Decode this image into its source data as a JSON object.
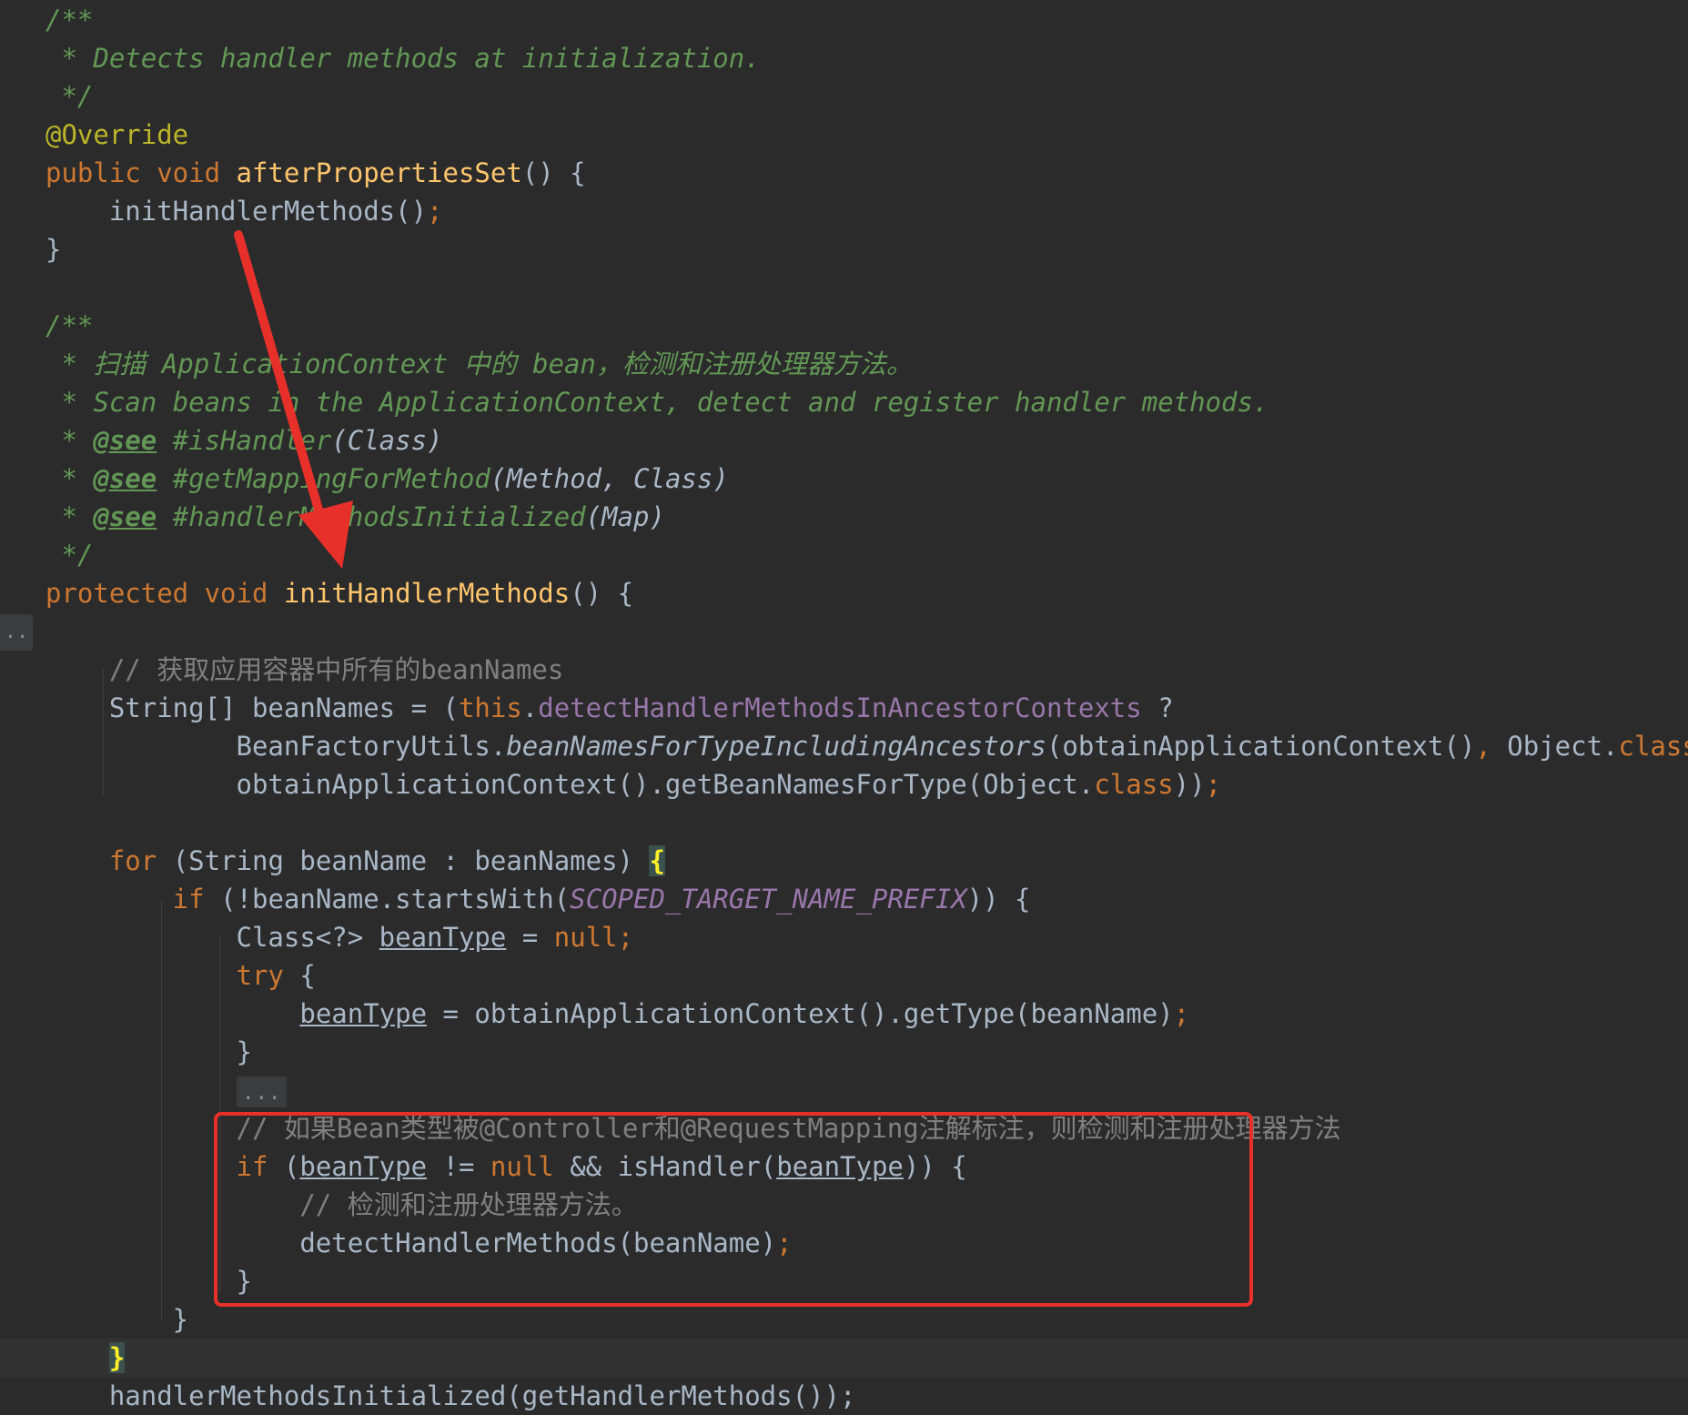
{
  "code": {
    "l01": "/**",
    "l02": " * Detects handler methods at initialization.",
    "l03": " */",
    "l04": "@Override",
    "l05_kw": "public void ",
    "l05_fn": "afterPropertiesSet",
    "l05_rest": "() {",
    "l06_call": "    initHandlerMethods()",
    "l06_semi": ";",
    "l07": "}",
    "l09": "/**",
    "l10": " * 扫描 ApplicationContext 中的 bean，检测和注册处理器方法。",
    "l11": " * Scan beans in the ApplicationContext, detect and register handler methods.",
    "l12_star": " * ",
    "l12_tag": "@see",
    "l12_ref": " #isHandler",
    "l12_params": "(Class)",
    "l13_star": " * ",
    "l13_tag": "@see",
    "l13_ref": " #getMappingForMethod",
    "l13_params": "(Method, Class)",
    "l14_star": " * ",
    "l14_tag": "@see",
    "l14_ref": " #handlerMethodsInitialized",
    "l14_params": "(Map)",
    "l15": " */",
    "l16_kw": "protected void ",
    "l16_fn": "initHandlerMethods",
    "l16_rest": "() {",
    "l18": "    // 获取应用容器中所有的beanNames",
    "l19_a": "    String[] beanNames = (",
    "l19_this": "this",
    "l19_dot": ".",
    "l19_field": "detectHandlerMethodsInAncestorContexts",
    "l19_q": " ?",
    "l20_a": "            BeanFactoryUtils.",
    "l20_static": "beanNamesForTypeIncludingAncestors",
    "l20_b": "(obtainApplicationContext()",
    "l20_comma": ",",
    "l20_c": " Object.",
    "l20_class": "class",
    "l20_d": ") :",
    "l21_a": "            obtainApplicationContext().getBeanNamesForType(Object.",
    "l21_class": "class",
    "l21_b": "))",
    "l21_semi": ";",
    "l23_kw": "    for ",
    "l23_a": "(String beanName : beanNames) ",
    "l23_brace": "{",
    "l24_kw": "        if ",
    "l24_a": "(!beanName.startsWith(",
    "l24_const": "SCOPED_TARGET_NAME_PREFIX",
    "l24_b": ")) {",
    "l25_a": "            Class<?> ",
    "l25_var": "beanType",
    "l25_b": " = ",
    "l25_null": "null",
    "l25_semi": ";",
    "l26_kw": "            try ",
    "l26_a": "{",
    "l27_pad": "                ",
    "l27_var": "beanType",
    "l27_a": " = obtainApplicationContext().getType(beanName)",
    "l27_semi": ";",
    "l28": "            }",
    "l29_pad": "            ",
    "l29_ellipsis": "...",
    "l30": "            // 如果Bean类型被@Controller和@RequestMapping注解标注，则检测和注册处理器方法",
    "l31_kw": "            if ",
    "l31_a": "(",
    "l31_var1": "beanType",
    "l31_b": " != ",
    "l31_null": "null",
    "l31_c": " && isHandler(",
    "l31_var2": "beanType",
    "l31_d": ")) {",
    "l32": "                // 检测和注册处理器方法。",
    "l33_a": "                detectHandlerMethods(beanName)",
    "l33_semi": ";",
    "l34": "            }",
    "l35": "        }",
    "l36_pad": "    ",
    "l36_brace": "}",
    "l37": "    handlerMethodsInitialized(getHandlerMethods());"
  },
  "gutter": {
    "fold_label": ".."
  },
  "colors": {
    "background": "#2b2b2b",
    "keyword": "#cc7832",
    "function": "#ffc66d",
    "doc_comment": "#629755",
    "comment": "#808080",
    "annotation": "#bbb529",
    "field": "#9876aa",
    "highlight_box": "#e8302a",
    "arrow": "#e8302a"
  }
}
